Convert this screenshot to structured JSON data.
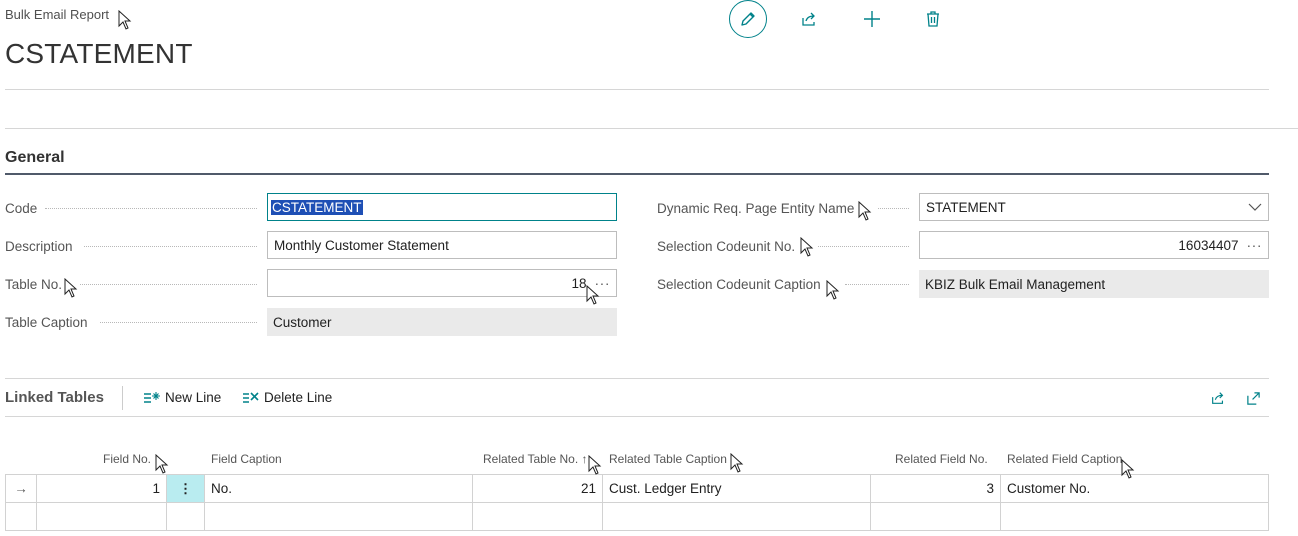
{
  "header": {
    "breadcrumb": "Bulk Email Report",
    "title": "CSTATEMENT",
    "actions": [
      {
        "name": "edit-button",
        "icon": "pencil-icon"
      },
      {
        "name": "share-button",
        "icon": "share-icon"
      },
      {
        "name": "new-button",
        "icon": "plus-icon"
      },
      {
        "name": "delete-button",
        "icon": "trash-icon"
      }
    ]
  },
  "general": {
    "title": "General",
    "fields": {
      "code": {
        "label": "Code",
        "value": "CSTATEMENT"
      },
      "description": {
        "label": "Description",
        "value": "Monthly Customer Statement"
      },
      "table_no": {
        "label": "Table No.",
        "value": "18"
      },
      "table_caption": {
        "label": "Table Caption",
        "value": "Customer"
      },
      "dynamic_req": {
        "label": "Dynamic Req. Page Entity Name",
        "value": "STATEMENT"
      },
      "selection_codeunit_no": {
        "label": "Selection Codeunit No.",
        "value": "16034407"
      },
      "selection_codeunit_caption": {
        "label": "Selection Codeunit Caption",
        "value": "KBIZ Bulk Email Management"
      }
    },
    "ellipsis": "···"
  },
  "linked_tables": {
    "title": "Linked Tables",
    "new_line": "New Line",
    "delete_line": "Delete Line",
    "columns": {
      "field_no": "Field No.",
      "field_caption": "Field Caption",
      "related_table_no": "Related Table No. ↑",
      "related_table_caption": "Related Table Caption",
      "related_field_no": "Related Field No.",
      "related_field_caption": "Related Field Caption"
    },
    "rows": [
      {
        "field_no": "1",
        "field_caption": "No.",
        "related_table_no": "21",
        "related_table_caption": "Cust. Ledger Entry",
        "related_field_no": "3",
        "related_field_caption": "Customer No."
      }
    ],
    "row_marker": "→",
    "row_menu": "⋮"
  },
  "colors": {
    "accent": "#00828a",
    "selection": "#1e4fb5",
    "row_highlight": "#b9ecf0"
  }
}
